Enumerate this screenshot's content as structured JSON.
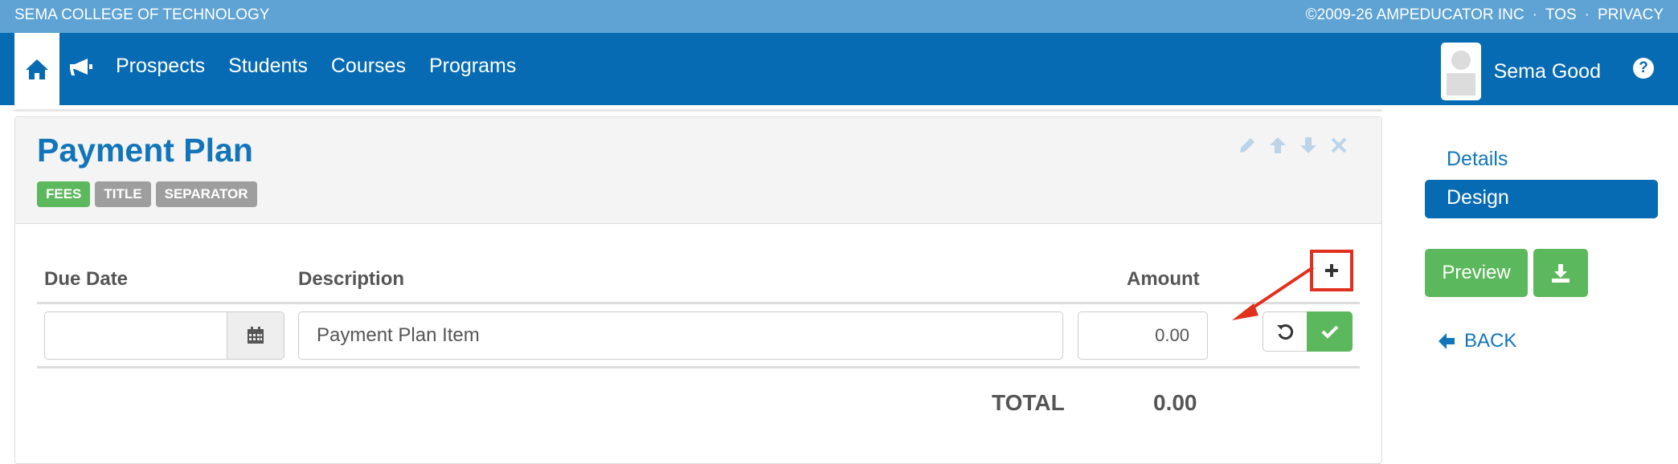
{
  "topbar": {
    "college": "SEMA COLLEGE OF TECHNOLOGY",
    "copyright": "©2009-26 AMPEDUCATOR INC",
    "tos": "TOS",
    "privacy": "PRIVACY",
    "separator": "·"
  },
  "nav": {
    "home_icon": "home-icon",
    "announce_icon": "megaphone-icon",
    "links": [
      "Prospects",
      "Students",
      "Courses",
      "Programs"
    ],
    "user_name": "Sema Good",
    "help_icon": "question-circle-icon",
    "help_glyph": "?"
  },
  "panel": {
    "title": "Payment Plan",
    "tags": [
      "FEES",
      "TITLE",
      "SEPARATOR"
    ],
    "tools": [
      "pencil-icon",
      "arrow-up-icon",
      "arrow-down-icon",
      "close-icon"
    ]
  },
  "table": {
    "headers": {
      "due_date": "Due Date",
      "description": "Description",
      "amount": "Amount"
    },
    "row": {
      "due_date": "",
      "description": "Payment Plan Item",
      "amount": "0.00"
    },
    "total_label": "TOTAL",
    "total_value": "0.00"
  },
  "sidebar": {
    "items": [
      {
        "label": "Details",
        "active": false
      },
      {
        "label": "Design",
        "active": true
      }
    ],
    "preview_label": "Preview",
    "back_label": "BACK"
  },
  "colors": {
    "topbar": "#5ea3d3",
    "navbar": "#066bb3",
    "accent_green": "#5cb85c",
    "annotation_red": "#e0311f"
  }
}
